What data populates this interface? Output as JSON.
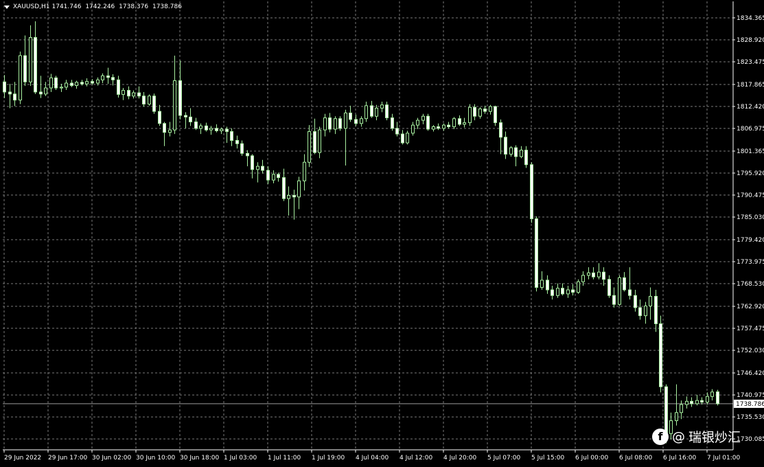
{
  "header": {
    "symbol": "XAUUSD,H1",
    "ohlc": [
      "1741.746",
      "1742.246",
      "1738.376",
      "1738.786"
    ]
  },
  "current_price_label": "1738.786",
  "watermark": {
    "logo": "f",
    "at": "@",
    "text": "瑞银炒汇"
  },
  "colors": {
    "background": "#000000",
    "grid": "#7a7a7a",
    "axis": "#ffffff",
    "candle": "#a8f0a0",
    "candle_bull_body": "#000000",
    "candle_bear_body": "#ffffff",
    "price_line": "#9a9a9a"
  },
  "chart_data": {
    "type": "candlestick",
    "symbol": "XAUUSD",
    "timeframe": "H1",
    "ylim": [
      1727.38,
      1838.44
    ],
    "y_ticks": [
      "1834.365",
      "1828.920",
      "1823.475",
      "1817.865",
      "1812.420",
      "1806.975",
      "1801.365",
      "1795.920",
      "1790.475",
      "1785.030",
      "1779.420",
      "1773.975",
      "1768.530",
      "1762.920",
      "1757.475",
      "1752.030",
      "1746.420",
      "1740.975",
      "1735.530",
      "1730.085"
    ],
    "x_ticks": [
      "29 Jun 2022",
      "29 Jun 17:00",
      "30 Jun 02:00",
      "30 Jun 10:00",
      "30 Jun 18:00",
      "1 Jul 03:00",
      "1 Jul 11:00",
      "1 Jul 19:00",
      "4 Jul 04:00",
      "4 Jul 12:00",
      "4 Jul 20:00",
      "5 Jul 07:00",
      "5 Jul 15:00",
      "6 Jul 00:00",
      "6 Jul 08:00",
      "6 Jul 16:00",
      "7 Jul 01:00"
    ],
    "grid": true,
    "current_price": 1738.786,
    "candles": [
      {
        "o": 1818.5,
        "h": 1820.2,
        "l": 1814.5,
        "c": 1816.0
      },
      {
        "o": 1816.0,
        "h": 1818.0,
        "l": 1812.0,
        "c": 1815.5
      },
      {
        "o": 1815.5,
        "h": 1818.5,
        "l": 1812.5,
        "c": 1814.0
      },
      {
        "o": 1814.0,
        "h": 1826.0,
        "l": 1813.0,
        "c": 1825.0
      },
      {
        "o": 1825.0,
        "h": 1830.0,
        "l": 1817.5,
        "c": 1818.5
      },
      {
        "o": 1818.5,
        "h": 1832.5,
        "l": 1817.5,
        "c": 1829.5
      },
      {
        "o": 1829.5,
        "h": 1833.5,
        "l": 1815.5,
        "c": 1816.0
      },
      {
        "o": 1816.0,
        "h": 1820.0,
        "l": 1814.5,
        "c": 1815.5
      },
      {
        "o": 1815.5,
        "h": 1818.5,
        "l": 1815.0,
        "c": 1817.0
      },
      {
        "o": 1817.0,
        "h": 1820.5,
        "l": 1816.0,
        "c": 1819.5
      },
      {
        "o": 1819.5,
        "h": 1820.0,
        "l": 1816.5,
        "c": 1817.0
      },
      {
        "o": 1817.0,
        "h": 1818.0,
        "l": 1816.0,
        "c": 1817.2
      },
      {
        "o": 1817.2,
        "h": 1819.0,
        "l": 1816.5,
        "c": 1818.2
      },
      {
        "o": 1818.2,
        "h": 1819.0,
        "l": 1817.2,
        "c": 1817.6
      },
      {
        "o": 1817.6,
        "h": 1818.8,
        "l": 1816.8,
        "c": 1818.4
      },
      {
        "o": 1818.4,
        "h": 1819.0,
        "l": 1817.6,
        "c": 1818.0
      },
      {
        "o": 1818.0,
        "h": 1819.4,
        "l": 1817.4,
        "c": 1818.6
      },
      {
        "o": 1818.6,
        "h": 1819.2,
        "l": 1817.8,
        "c": 1818.2
      },
      {
        "o": 1818.2,
        "h": 1819.6,
        "l": 1817.6,
        "c": 1819.0
      },
      {
        "o": 1819.0,
        "h": 1820.6,
        "l": 1818.2,
        "c": 1820.0
      },
      {
        "o": 1820.0,
        "h": 1822.0,
        "l": 1818.0,
        "c": 1819.6
      },
      {
        "o": 1819.6,
        "h": 1820.4,
        "l": 1817.6,
        "c": 1819.0
      },
      {
        "o": 1819.0,
        "h": 1820.0,
        "l": 1814.6,
        "c": 1815.4
      },
      {
        "o": 1815.4,
        "h": 1817.0,
        "l": 1814.0,
        "c": 1816.4
      },
      {
        "o": 1816.4,
        "h": 1817.4,
        "l": 1814.2,
        "c": 1815.0
      },
      {
        "o": 1815.0,
        "h": 1816.4,
        "l": 1814.4,
        "c": 1815.8
      },
      {
        "o": 1815.8,
        "h": 1817.4,
        "l": 1814.4,
        "c": 1815.0
      },
      {
        "o": 1815.0,
        "h": 1816.0,
        "l": 1812.4,
        "c": 1813.0
      },
      {
        "o": 1813.0,
        "h": 1815.4,
        "l": 1812.6,
        "c": 1815.0
      },
      {
        "o": 1815.0,
        "h": 1815.6,
        "l": 1810.6,
        "c": 1811.2
      },
      {
        "o": 1811.2,
        "h": 1812.8,
        "l": 1807.6,
        "c": 1808.2
      },
      {
        "o": 1808.2,
        "h": 1808.6,
        "l": 1802.6,
        "c": 1806.0
      },
      {
        "o": 1806.0,
        "h": 1808.6,
        "l": 1805.0,
        "c": 1806.6
      },
      {
        "o": 1806.6,
        "h": 1825.0,
        "l": 1805.6,
        "c": 1818.8
      },
      {
        "o": 1818.8,
        "h": 1823.8,
        "l": 1809.2,
        "c": 1810.2
      },
      {
        "o": 1810.2,
        "h": 1811.0,
        "l": 1807.0,
        "c": 1809.8
      },
      {
        "o": 1809.8,
        "h": 1812.0,
        "l": 1807.6,
        "c": 1808.6
      },
      {
        "o": 1808.6,
        "h": 1809.6,
        "l": 1806.6,
        "c": 1807.0
      },
      {
        "o": 1807.0,
        "h": 1808.2,
        "l": 1805.6,
        "c": 1807.6
      },
      {
        "o": 1807.6,
        "h": 1808.4,
        "l": 1806.2,
        "c": 1806.6
      },
      {
        "o": 1806.6,
        "h": 1807.6,
        "l": 1805.4,
        "c": 1807.0
      },
      {
        "o": 1807.0,
        "h": 1808.0,
        "l": 1806.0,
        "c": 1806.4
      },
      {
        "o": 1806.4,
        "h": 1807.2,
        "l": 1805.6,
        "c": 1806.8
      },
      {
        "o": 1806.8,
        "h": 1807.4,
        "l": 1803.4,
        "c": 1806.2
      },
      {
        "o": 1806.2,
        "h": 1807.0,
        "l": 1802.6,
        "c": 1804.0
      },
      {
        "o": 1804.0,
        "h": 1805.2,
        "l": 1802.0,
        "c": 1803.2
      },
      {
        "o": 1803.2,
        "h": 1804.0,
        "l": 1800.2,
        "c": 1800.8
      },
      {
        "o": 1800.8,
        "h": 1801.6,
        "l": 1797.6,
        "c": 1800.2
      },
      {
        "o": 1800.2,
        "h": 1800.6,
        "l": 1794.6,
        "c": 1796.8
      },
      {
        "o": 1796.8,
        "h": 1798.6,
        "l": 1793.6,
        "c": 1797.6
      },
      {
        "o": 1797.6,
        "h": 1799.2,
        "l": 1795.8,
        "c": 1796.6
      },
      {
        "o": 1796.6,
        "h": 1797.6,
        "l": 1793.2,
        "c": 1794.2
      },
      {
        "o": 1794.2,
        "h": 1796.6,
        "l": 1793.4,
        "c": 1795.6
      },
      {
        "o": 1795.6,
        "h": 1796.0,
        "l": 1793.8,
        "c": 1794.8
      },
      {
        "o": 1794.8,
        "h": 1797.0,
        "l": 1789.0,
        "c": 1789.6
      },
      {
        "o": 1789.6,
        "h": 1792.6,
        "l": 1785.4,
        "c": 1790.4
      },
      {
        "o": 1790.4,
        "h": 1791.8,
        "l": 1784.4,
        "c": 1790.0
      },
      {
        "o": 1790.0,
        "h": 1795.0,
        "l": 1787.0,
        "c": 1794.0
      },
      {
        "o": 1794.0,
        "h": 1800.6,
        "l": 1791.6,
        "c": 1798.6
      },
      {
        "o": 1798.6,
        "h": 1807.8,
        "l": 1797.4,
        "c": 1806.2
      },
      {
        "o": 1806.2,
        "h": 1809.4,
        "l": 1800.6,
        "c": 1801.0
      },
      {
        "o": 1801.0,
        "h": 1807.4,
        "l": 1799.6,
        "c": 1806.6
      },
      {
        "o": 1806.6,
        "h": 1810.6,
        "l": 1805.0,
        "c": 1809.6
      },
      {
        "o": 1809.6,
        "h": 1810.8,
        "l": 1806.0,
        "c": 1806.8
      },
      {
        "o": 1806.8,
        "h": 1810.0,
        "l": 1805.6,
        "c": 1809.4
      },
      {
        "o": 1809.4,
        "h": 1810.0,
        "l": 1806.4,
        "c": 1807.0
      },
      {
        "o": 1807.0,
        "h": 1811.6,
        "l": 1797.8,
        "c": 1810.8
      },
      {
        "o": 1810.8,
        "h": 1812.6,
        "l": 1808.6,
        "c": 1809.2
      },
      {
        "o": 1809.2,
        "h": 1810.4,
        "l": 1807.6,
        "c": 1808.2
      },
      {
        "o": 1808.2,
        "h": 1810.0,
        "l": 1807.4,
        "c": 1809.4
      },
      {
        "o": 1809.4,
        "h": 1813.6,
        "l": 1808.6,
        "c": 1812.6
      },
      {
        "o": 1812.6,
        "h": 1813.8,
        "l": 1809.6,
        "c": 1810.0
      },
      {
        "o": 1810.0,
        "h": 1812.8,
        "l": 1809.0,
        "c": 1812.0
      },
      {
        "o": 1812.0,
        "h": 1813.6,
        "l": 1811.0,
        "c": 1812.8
      },
      {
        "o": 1812.8,
        "h": 1813.6,
        "l": 1809.0,
        "c": 1809.6
      },
      {
        "o": 1809.6,
        "h": 1810.6,
        "l": 1806.4,
        "c": 1807.0
      },
      {
        "o": 1807.0,
        "h": 1808.6,
        "l": 1805.0,
        "c": 1805.6
      },
      {
        "o": 1805.6,
        "h": 1806.6,
        "l": 1803.0,
        "c": 1803.4
      },
      {
        "o": 1803.4,
        "h": 1806.4,
        "l": 1803.0,
        "c": 1805.8
      },
      {
        "o": 1805.8,
        "h": 1808.6,
        "l": 1805.2,
        "c": 1807.8
      },
      {
        "o": 1807.8,
        "h": 1809.6,
        "l": 1806.8,
        "c": 1809.0
      },
      {
        "o": 1809.0,
        "h": 1810.6,
        "l": 1808.0,
        "c": 1810.0
      },
      {
        "o": 1810.0,
        "h": 1810.6,
        "l": 1806.4,
        "c": 1806.8
      },
      {
        "o": 1806.8,
        "h": 1807.8,
        "l": 1806.2,
        "c": 1807.4
      },
      {
        "o": 1807.4,
        "h": 1808.2,
        "l": 1806.6,
        "c": 1807.0
      },
      {
        "o": 1807.0,
        "h": 1808.2,
        "l": 1806.4,
        "c": 1807.8
      },
      {
        "o": 1807.8,
        "h": 1808.6,
        "l": 1807.0,
        "c": 1807.4
      },
      {
        "o": 1807.4,
        "h": 1809.8,
        "l": 1806.8,
        "c": 1809.4
      },
      {
        "o": 1809.4,
        "h": 1810.2,
        "l": 1807.6,
        "c": 1808.0
      },
      {
        "o": 1808.0,
        "h": 1809.6,
        "l": 1807.2,
        "c": 1808.4
      },
      {
        "o": 1808.4,
        "h": 1813.0,
        "l": 1807.6,
        "c": 1812.2
      },
      {
        "o": 1812.2,
        "h": 1813.0,
        "l": 1809.0,
        "c": 1810.0
      },
      {
        "o": 1810.0,
        "h": 1812.2,
        "l": 1809.4,
        "c": 1811.8
      },
      {
        "o": 1811.8,
        "h": 1812.6,
        "l": 1810.6,
        "c": 1811.2
      },
      {
        "o": 1811.2,
        "h": 1812.8,
        "l": 1810.4,
        "c": 1812.4
      },
      {
        "o": 1812.4,
        "h": 1812.6,
        "l": 1807.6,
        "c": 1808.4
      },
      {
        "o": 1808.4,
        "h": 1809.2,
        "l": 1800.6,
        "c": 1804.8
      },
      {
        "o": 1804.8,
        "h": 1806.2,
        "l": 1799.4,
        "c": 1800.6
      },
      {
        "o": 1800.6,
        "h": 1802.6,
        "l": 1800.0,
        "c": 1802.2
      },
      {
        "o": 1802.2,
        "h": 1802.8,
        "l": 1797.6,
        "c": 1800.0
      },
      {
        "o": 1800.0,
        "h": 1802.6,
        "l": 1799.6,
        "c": 1801.6
      },
      {
        "o": 1801.6,
        "h": 1802.6,
        "l": 1797.2,
        "c": 1798.0
      },
      {
        "o": 1798.0,
        "h": 1798.6,
        "l": 1783.6,
        "c": 1784.6
      },
      {
        "o": 1784.6,
        "h": 1785.2,
        "l": 1766.6,
        "c": 1767.6
      },
      {
        "o": 1767.6,
        "h": 1771.6,
        "l": 1767.0,
        "c": 1769.4
      },
      {
        "o": 1769.4,
        "h": 1770.6,
        "l": 1766.0,
        "c": 1767.0
      },
      {
        "o": 1767.0,
        "h": 1768.0,
        "l": 1764.6,
        "c": 1765.6
      },
      {
        "o": 1765.6,
        "h": 1768.6,
        "l": 1765.0,
        "c": 1767.4
      },
      {
        "o": 1767.4,
        "h": 1768.6,
        "l": 1765.6,
        "c": 1766.0
      },
      {
        "o": 1766.0,
        "h": 1768.0,
        "l": 1765.0,
        "c": 1767.0
      },
      {
        "o": 1767.0,
        "h": 1768.4,
        "l": 1765.6,
        "c": 1766.4
      },
      {
        "o": 1766.4,
        "h": 1769.6,
        "l": 1766.0,
        "c": 1769.0
      },
      {
        "o": 1769.0,
        "h": 1771.6,
        "l": 1768.0,
        "c": 1770.6
      },
      {
        "o": 1770.6,
        "h": 1772.6,
        "l": 1769.6,
        "c": 1771.2
      },
      {
        "o": 1771.2,
        "h": 1772.6,
        "l": 1769.6,
        "c": 1770.2
      },
      {
        "o": 1770.2,
        "h": 1773.6,
        "l": 1769.6,
        "c": 1771.4
      },
      {
        "o": 1771.4,
        "h": 1772.6,
        "l": 1768.0,
        "c": 1769.6
      },
      {
        "o": 1769.6,
        "h": 1770.6,
        "l": 1765.0,
        "c": 1765.6
      },
      {
        "o": 1765.6,
        "h": 1767.6,
        "l": 1762.6,
        "c": 1763.4
      },
      {
        "o": 1763.4,
        "h": 1770.6,
        "l": 1763.0,
        "c": 1770.0
      },
      {
        "o": 1770.0,
        "h": 1771.4,
        "l": 1766.6,
        "c": 1767.0
      },
      {
        "o": 1767.0,
        "h": 1772.6,
        "l": 1764.6,
        "c": 1765.6
      },
      {
        "o": 1765.6,
        "h": 1767.0,
        "l": 1761.6,
        "c": 1762.6
      },
      {
        "o": 1762.6,
        "h": 1764.6,
        "l": 1759.6,
        "c": 1760.6
      },
      {
        "o": 1760.6,
        "h": 1764.0,
        "l": 1758.6,
        "c": 1763.0
      },
      {
        "o": 1763.0,
        "h": 1767.6,
        "l": 1759.6,
        "c": 1765.4
      },
      {
        "o": 1765.4,
        "h": 1767.0,
        "l": 1756.6,
        "c": 1758.6
      },
      {
        "o": 1758.6,
        "h": 1760.6,
        "l": 1741.6,
        "c": 1743.0
      },
      {
        "o": 1743.0,
        "h": 1743.6,
        "l": 1729.0,
        "c": 1731.4
      },
      {
        "o": 1731.4,
        "h": 1736.6,
        "l": 1730.0,
        "c": 1734.6
      },
      {
        "o": 1734.6,
        "h": 1743.6,
        "l": 1733.4,
        "c": 1736.6
      },
      {
        "o": 1736.6,
        "h": 1739.6,
        "l": 1735.0,
        "c": 1738.6
      },
      {
        "o": 1738.6,
        "h": 1740.6,
        "l": 1737.6,
        "c": 1739.4
      },
      {
        "o": 1739.4,
        "h": 1740.4,
        "l": 1738.0,
        "c": 1738.8
      },
      {
        "o": 1738.8,
        "h": 1741.0,
        "l": 1738.4,
        "c": 1739.6
      },
      {
        "o": 1739.6,
        "h": 1740.4,
        "l": 1738.6,
        "c": 1739.2
      },
      {
        "o": 1739.2,
        "h": 1741.6,
        "l": 1738.6,
        "c": 1740.6
      },
      {
        "o": 1740.6,
        "h": 1742.4,
        "l": 1739.6,
        "c": 1741.7
      },
      {
        "o": 1741.746,
        "h": 1742.246,
        "l": 1738.376,
        "c": 1738.786
      }
    ]
  }
}
